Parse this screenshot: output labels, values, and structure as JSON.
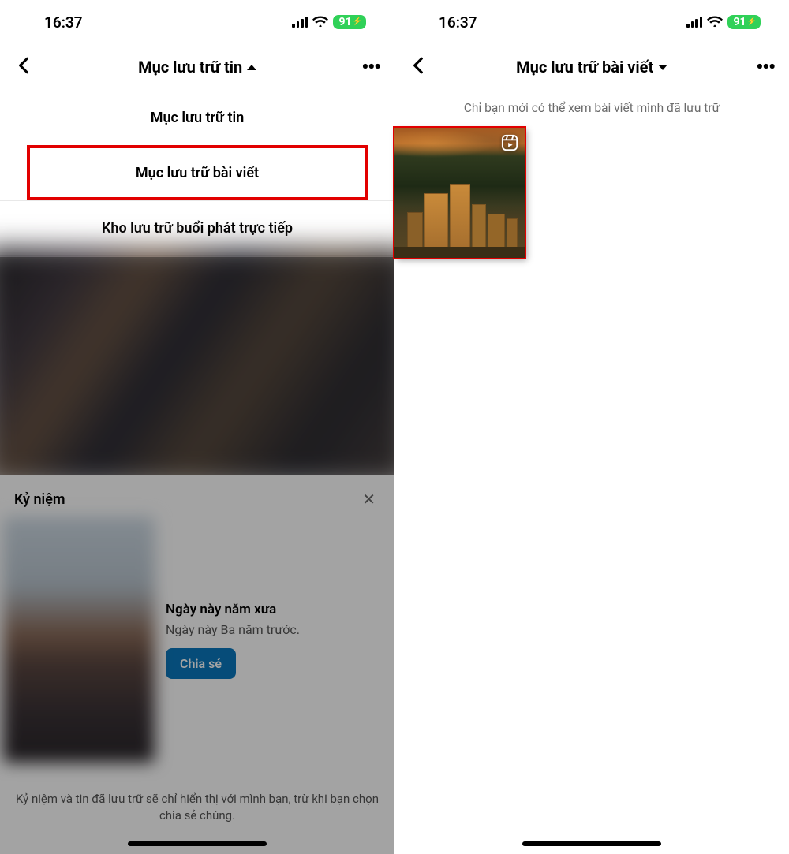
{
  "status": {
    "time": "16:37",
    "battery": "91"
  },
  "left": {
    "nav_title": "Mục lưu trữ tin",
    "dropdown": {
      "option1": "Mục lưu trữ tin",
      "option2": "Mục lưu trữ bài viết",
      "option3": "Kho lưu trữ buổi phát trực tiếp"
    },
    "memories": {
      "title": "Kỷ niệm",
      "heading": "Ngày này năm xưa",
      "sub": "Ngày này Ba năm trước.",
      "share_label": "Chia sẻ"
    },
    "footer": "Kỷ niệm và tin đã lưu trữ sẽ chỉ hiển thị với mình bạn, trừ khi bạn chọn chia sẻ chúng."
  },
  "right": {
    "nav_title": "Mục lưu trữ bài viết",
    "info": "Chỉ bạn mới có thể xem bài viết mình đã lưu trữ"
  },
  "colors": {
    "highlight": "#e20000",
    "battery_green": "#30d158",
    "share_blue": "#0a78be"
  }
}
